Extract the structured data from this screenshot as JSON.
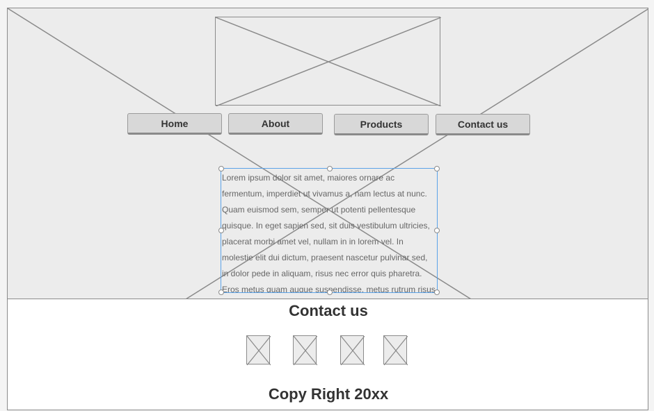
{
  "nav": {
    "items": [
      {
        "label": "Home"
      },
      {
        "label": "About"
      },
      {
        "label": "Products"
      },
      {
        "label": "Contact us"
      }
    ]
  },
  "content": {
    "body_text": "Lorem ipsum dolor sit amet, maiores ornare ac fermentum, imperdiet ut vivamus a, nam lectus at nunc. Quam euismod sem, semper ut potenti pellentesque quisque. In eget sapien sed, sit duis vestibulum ultricies, placerat morbi amet vel, nullam in in lorem vel. In molestie elit dui dictum, praesent nascetur pulvinar sed, in dolor pede in aliquam, risus nec error quis pharetra. Eros metus quam augue suspendisse, metus rutrum risus erat in. In ultrices quo ut lectus, etiam"
  },
  "footer": {
    "title": "Contact us",
    "social_icons": [
      "image-placeholder-icon",
      "image-placeholder-icon",
      "image-placeholder-icon",
      "image-placeholder-icon"
    ],
    "copyright": "Copy Right 20xx"
  },
  "colors": {
    "canvas": "#ececec",
    "outline": "#8a8a8a",
    "selection": "#5aa2e8",
    "footer_bg": "#ffffff"
  }
}
